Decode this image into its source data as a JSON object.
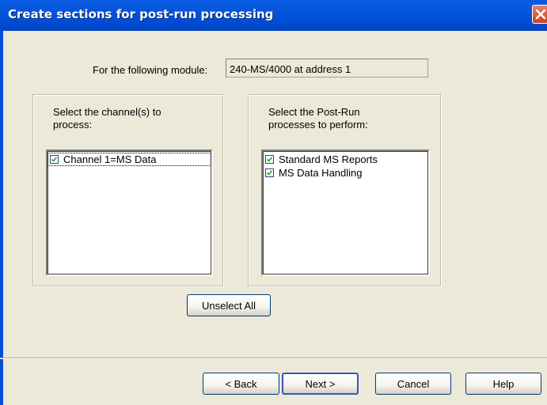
{
  "window": {
    "title": "Create sections for post-run processing",
    "close_icon": "close-icon"
  },
  "module": {
    "label": "For the following module:",
    "value": "240-MS/4000 at address 1"
  },
  "channels": {
    "title_line1": "Select the channel(s) to",
    "title_line2": "process:",
    "items": [
      {
        "label": "Channel 1=MS Data",
        "checked": true
      }
    ]
  },
  "processes": {
    "title_line1": "Select the Post-Run",
    "title_line2": "processes to perform:",
    "items": [
      {
        "label": "Standard MS Reports",
        "checked": true
      },
      {
        "label": "MS Data Handling",
        "checked": true
      }
    ]
  },
  "buttons": {
    "unselect_all": "Unselect All",
    "back": "< Back",
    "next": "Next >",
    "cancel": "Cancel",
    "help": "Help"
  },
  "colors": {
    "titlebar": "#0050d8",
    "dialog_bg": "#ece9d8",
    "default_button_border": "#2f5bb5"
  }
}
